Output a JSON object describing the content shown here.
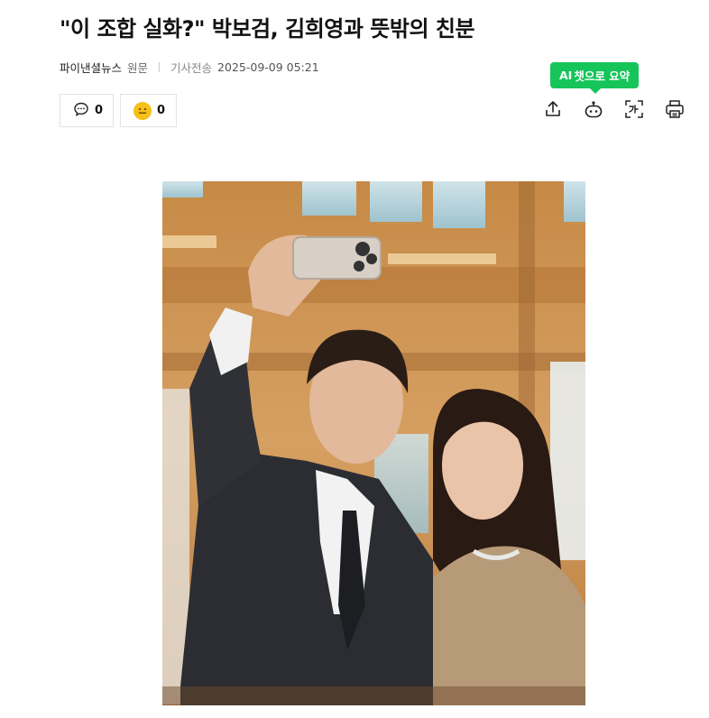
{
  "article": {
    "title": "\"이 조합 실화?\" 박보검, 김희영과 뜻밖의 친분",
    "source": "파이낸셜뉴스",
    "original_link": "원문",
    "date_label": "기사전송",
    "date": "2025-09-09 05:21"
  },
  "reactions": {
    "comment_count": "0",
    "like_count": "0"
  },
  "toolbar": {
    "ai_tooltip_ai": "AI",
    "ai_tooltip_text": "챗으로 요약",
    "icons": [
      "share-icon",
      "ai-summary-icon",
      "translate-icon",
      "print-icon"
    ]
  },
  "colors": {
    "accent_green": "#15c55a",
    "like_yellow": "#f4c019"
  }
}
